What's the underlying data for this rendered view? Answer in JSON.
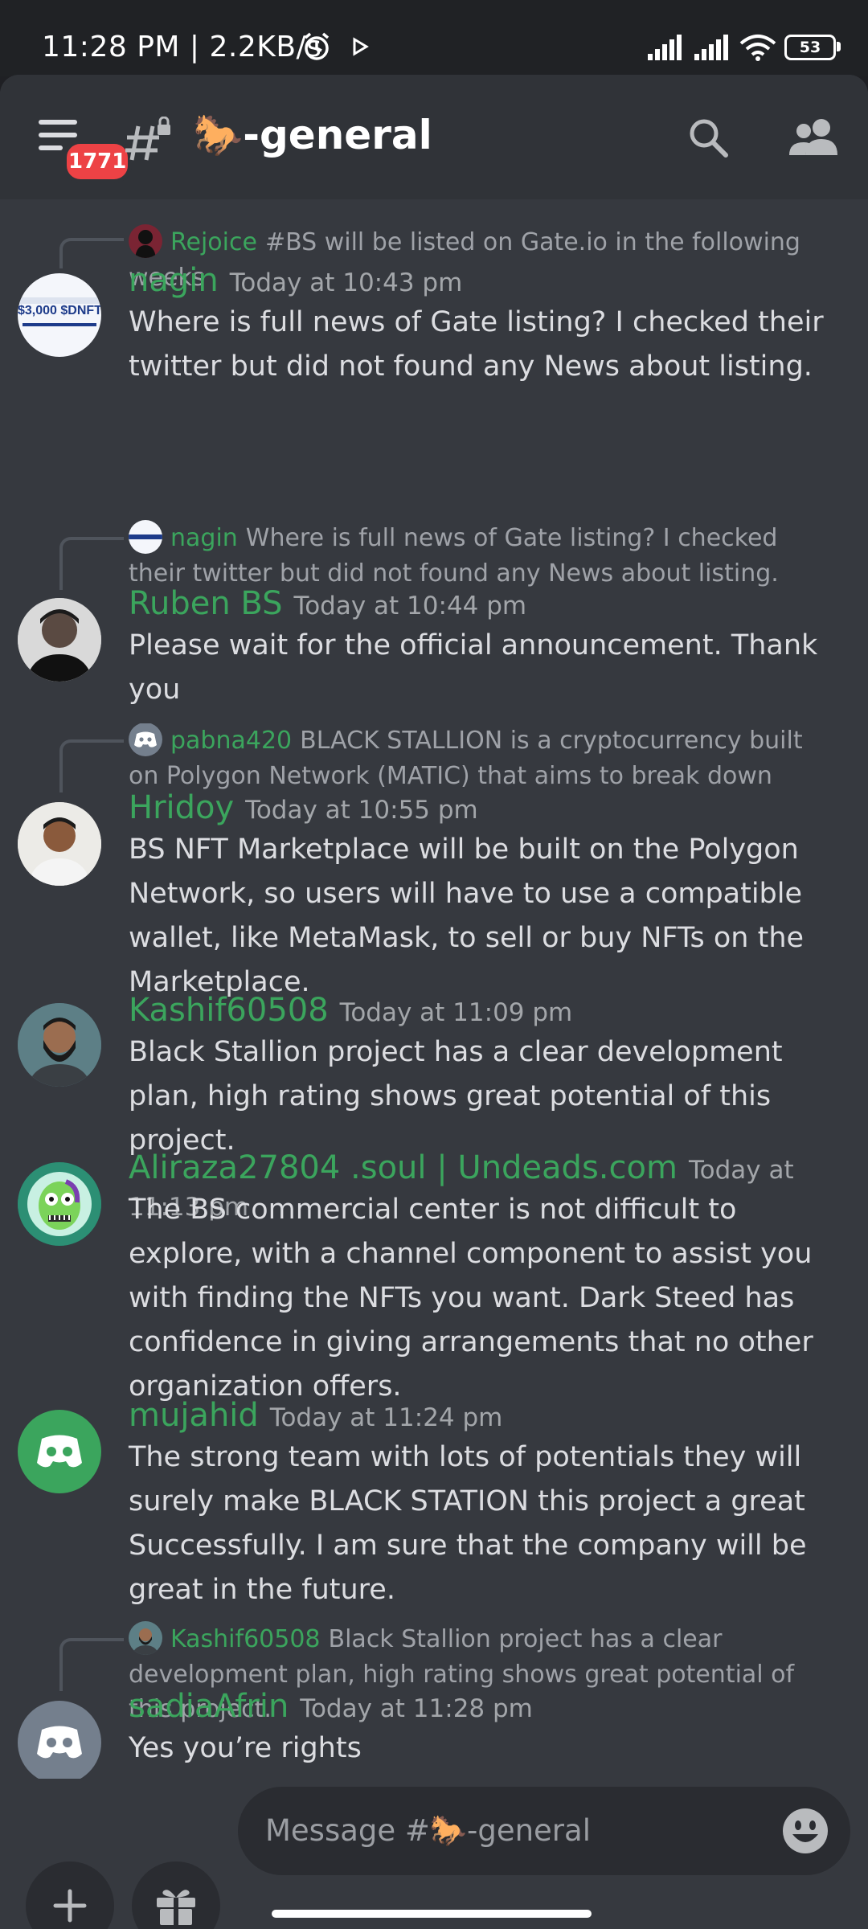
{
  "status_bar": {
    "time_speed": "11:28 PM | 2.2KB/s",
    "battery": "53"
  },
  "header": {
    "unread_badge": "1771",
    "channel_name": "🐎-general"
  },
  "messages": [
    {
      "reply": {
        "author": "Rejoice",
        "text": "#BS will be listed on Gate.io in the following weeks"
      },
      "author": "nagin",
      "timestamp": "Today at 10:43 pm",
      "text": "Where is full news of Gate listing? I checked their twitter but did not found any News about listing."
    },
    {
      "reply": {
        "author": "nagin",
        "text": "Where is full news of Gate listing? I checked their twitter but did not found any News about listing."
      },
      "author": "Ruben BS",
      "timestamp": "Today at 10:44 pm",
      "text": "Please wait for the official announcement. Thank you"
    },
    {
      "reply": {
        "author": "pabna420",
        "text": "BLACK STALLION is a cryptocurrency built on Polygon Network (MATIC) that aims to break down barriers in"
      },
      "author": "Hridoy",
      "timestamp": "Today at 10:55 pm",
      "text": "BS NFT Marketplace will be built on the Polygon Network, so users will have to use a compatible wallet, like MetaMask, to sell or buy NFTs on the Marketplace."
    },
    {
      "author": "Kashif60508",
      "timestamp": "Today at 11:09 pm",
      "text": "Black Stallion project has a clear development plan, high rating shows great potential of this project."
    },
    {
      "author": "Aliraza27804 .soul | Undeads.com",
      "timestamp": "Today at 11:13 pm",
      "text": "The BS commercial center is not difficult to explore, with a channel component to assist you with finding the NFTs you want. Dark Steed has confidence in giving arrangements that no other organization offers."
    },
    {
      "author": "mujahid",
      "timestamp": "Today at 11:24 pm",
      "text": "The strong team with lots of potentials they will surely make BLACK STATION this project a great Successfully. I am sure that the company will be great in the future."
    },
    {
      "reply": {
        "author": "Kashif60508",
        "text": "Black Stallion project has a clear development plan, high rating shows great potential of this project."
      },
      "author": "sadiaAfrin",
      "timestamp": "Today at 11:28 pm",
      "text": "Yes you’re rights"
    }
  ],
  "avatar_text": {
    "nagin": "$3,000 $DNFT"
  },
  "composer": {
    "placeholder": "Message #🐎-general"
  },
  "colors": {
    "username": "#3ba55d",
    "background": "#36393f",
    "badge": "#ed4245",
    "discord_blurple_green": "#3ba55d"
  }
}
